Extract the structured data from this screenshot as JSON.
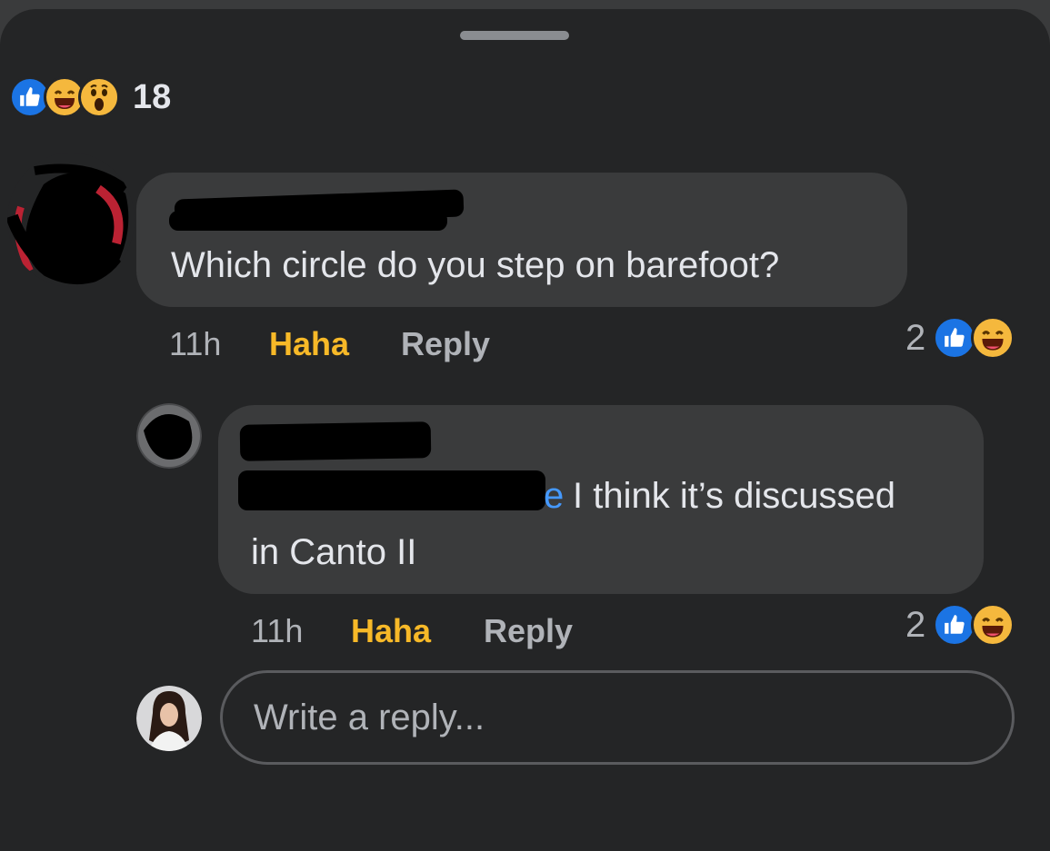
{
  "post_reactions": {
    "icons": [
      "like-icon",
      "haha-icon",
      "wow-icon"
    ],
    "count": "18"
  },
  "comments": [
    {
      "author": "",
      "text": "Which circle do you step on barefoot?",
      "time": "11h",
      "reaction_label": "Haha",
      "reply_label": "Reply",
      "reaction_count": "2",
      "reaction_icons": [
        "like-icon",
        "haha-icon"
      ]
    },
    {
      "author": "",
      "mention_visible_tail": "e",
      "text_line1": "I think it’s discussed",
      "text_line2": "in Canto II",
      "time": "11h",
      "reaction_label": "Haha",
      "reply_label": "Reply",
      "reaction_count": "2",
      "reaction_icons": [
        "like-icon",
        "haha-icon"
      ]
    }
  ],
  "reply_box": {
    "placeholder": "Write a reply..."
  },
  "colors": {
    "background": "#242526",
    "bubble": "#3a3b3c",
    "text": "#e4e6eb",
    "muted": "#b0b3b8",
    "haha_accent": "#f7b928",
    "like_blue": "#1b74e4",
    "mention_blue": "#4599ff"
  }
}
